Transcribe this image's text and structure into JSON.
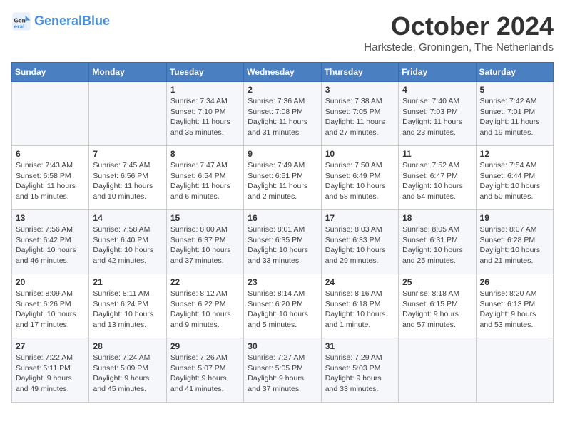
{
  "header": {
    "logo_line1": "General",
    "logo_line2": "Blue",
    "month": "October 2024",
    "location": "Harkstede, Groningen, The Netherlands"
  },
  "weekdays": [
    "Sunday",
    "Monday",
    "Tuesday",
    "Wednesday",
    "Thursday",
    "Friday",
    "Saturday"
  ],
  "weeks": [
    [
      {
        "num": "",
        "info": ""
      },
      {
        "num": "",
        "info": ""
      },
      {
        "num": "1",
        "info": "Sunrise: 7:34 AM\nSunset: 7:10 PM\nDaylight: 11 hours and 35 minutes."
      },
      {
        "num": "2",
        "info": "Sunrise: 7:36 AM\nSunset: 7:08 PM\nDaylight: 11 hours and 31 minutes."
      },
      {
        "num": "3",
        "info": "Sunrise: 7:38 AM\nSunset: 7:05 PM\nDaylight: 11 hours and 27 minutes."
      },
      {
        "num": "4",
        "info": "Sunrise: 7:40 AM\nSunset: 7:03 PM\nDaylight: 11 hours and 23 minutes."
      },
      {
        "num": "5",
        "info": "Sunrise: 7:42 AM\nSunset: 7:01 PM\nDaylight: 11 hours and 19 minutes."
      }
    ],
    [
      {
        "num": "6",
        "info": "Sunrise: 7:43 AM\nSunset: 6:58 PM\nDaylight: 11 hours and 15 minutes."
      },
      {
        "num": "7",
        "info": "Sunrise: 7:45 AM\nSunset: 6:56 PM\nDaylight: 11 hours and 10 minutes."
      },
      {
        "num": "8",
        "info": "Sunrise: 7:47 AM\nSunset: 6:54 PM\nDaylight: 11 hours and 6 minutes."
      },
      {
        "num": "9",
        "info": "Sunrise: 7:49 AM\nSunset: 6:51 PM\nDaylight: 11 hours and 2 minutes."
      },
      {
        "num": "10",
        "info": "Sunrise: 7:50 AM\nSunset: 6:49 PM\nDaylight: 10 hours and 58 minutes."
      },
      {
        "num": "11",
        "info": "Sunrise: 7:52 AM\nSunset: 6:47 PM\nDaylight: 10 hours and 54 minutes."
      },
      {
        "num": "12",
        "info": "Sunrise: 7:54 AM\nSunset: 6:44 PM\nDaylight: 10 hours and 50 minutes."
      }
    ],
    [
      {
        "num": "13",
        "info": "Sunrise: 7:56 AM\nSunset: 6:42 PM\nDaylight: 10 hours and 46 minutes."
      },
      {
        "num": "14",
        "info": "Sunrise: 7:58 AM\nSunset: 6:40 PM\nDaylight: 10 hours and 42 minutes."
      },
      {
        "num": "15",
        "info": "Sunrise: 8:00 AM\nSunset: 6:37 PM\nDaylight: 10 hours and 37 minutes."
      },
      {
        "num": "16",
        "info": "Sunrise: 8:01 AM\nSunset: 6:35 PM\nDaylight: 10 hours and 33 minutes."
      },
      {
        "num": "17",
        "info": "Sunrise: 8:03 AM\nSunset: 6:33 PM\nDaylight: 10 hours and 29 minutes."
      },
      {
        "num": "18",
        "info": "Sunrise: 8:05 AM\nSunset: 6:31 PM\nDaylight: 10 hours and 25 minutes."
      },
      {
        "num": "19",
        "info": "Sunrise: 8:07 AM\nSunset: 6:28 PM\nDaylight: 10 hours and 21 minutes."
      }
    ],
    [
      {
        "num": "20",
        "info": "Sunrise: 8:09 AM\nSunset: 6:26 PM\nDaylight: 10 hours and 17 minutes."
      },
      {
        "num": "21",
        "info": "Sunrise: 8:11 AM\nSunset: 6:24 PM\nDaylight: 10 hours and 13 minutes."
      },
      {
        "num": "22",
        "info": "Sunrise: 8:12 AM\nSunset: 6:22 PM\nDaylight: 10 hours and 9 minutes."
      },
      {
        "num": "23",
        "info": "Sunrise: 8:14 AM\nSunset: 6:20 PM\nDaylight: 10 hours and 5 minutes."
      },
      {
        "num": "24",
        "info": "Sunrise: 8:16 AM\nSunset: 6:18 PM\nDaylight: 10 hours and 1 minute."
      },
      {
        "num": "25",
        "info": "Sunrise: 8:18 AM\nSunset: 6:15 PM\nDaylight: 9 hours and 57 minutes."
      },
      {
        "num": "26",
        "info": "Sunrise: 8:20 AM\nSunset: 6:13 PM\nDaylight: 9 hours and 53 minutes."
      }
    ],
    [
      {
        "num": "27",
        "info": "Sunrise: 7:22 AM\nSunset: 5:11 PM\nDaylight: 9 hours and 49 minutes."
      },
      {
        "num": "28",
        "info": "Sunrise: 7:24 AM\nSunset: 5:09 PM\nDaylight: 9 hours and 45 minutes."
      },
      {
        "num": "29",
        "info": "Sunrise: 7:26 AM\nSunset: 5:07 PM\nDaylight: 9 hours and 41 minutes."
      },
      {
        "num": "30",
        "info": "Sunrise: 7:27 AM\nSunset: 5:05 PM\nDaylight: 9 hours and 37 minutes."
      },
      {
        "num": "31",
        "info": "Sunrise: 7:29 AM\nSunset: 5:03 PM\nDaylight: 9 hours and 33 minutes."
      },
      {
        "num": "",
        "info": ""
      },
      {
        "num": "",
        "info": ""
      }
    ]
  ]
}
